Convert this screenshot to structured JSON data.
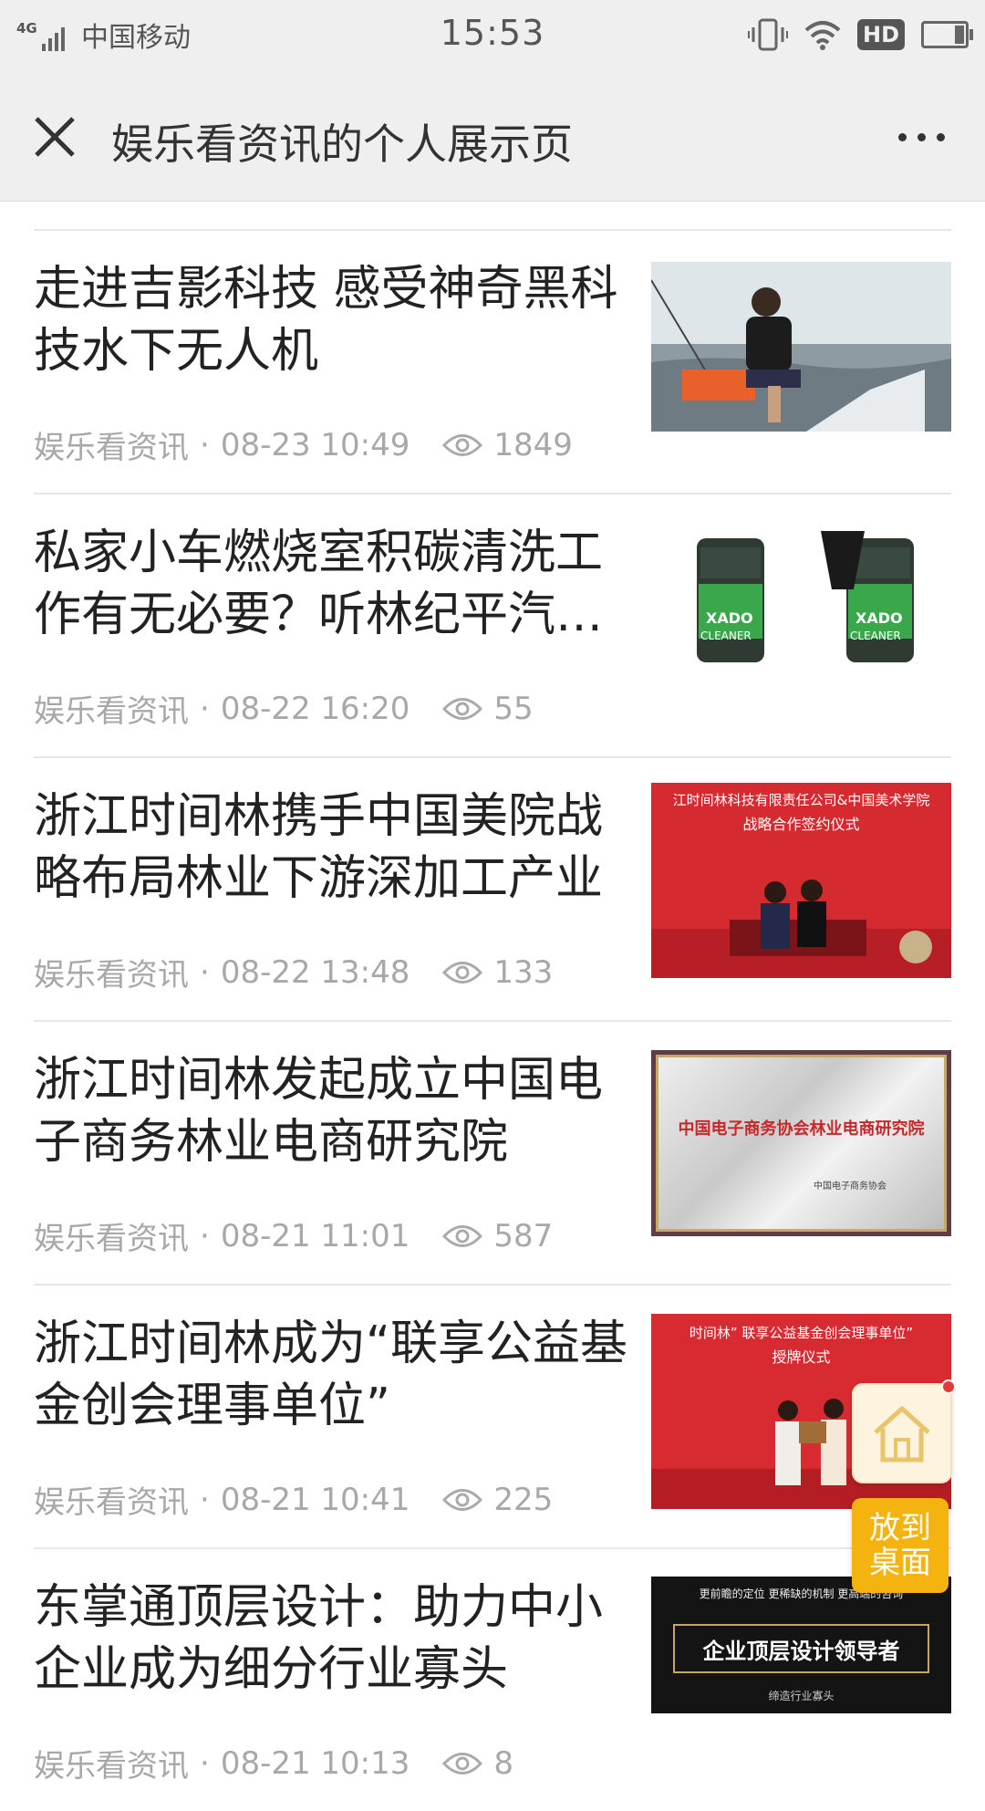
{
  "status_bar": {
    "network": "4G",
    "carrier": "中国移动",
    "time": "15:53",
    "hd": "HD"
  },
  "navbar": {
    "title": "娱乐看资讯的个人展示页"
  },
  "articles": [
    {
      "title": "走进吉影科技 感受神奇黑科技水下无人机",
      "source": "娱乐看资讯",
      "time": "08-23 10:49",
      "views": "1849"
    },
    {
      "title": "私家小车燃烧室积碳清洗工作有无必要？听林纪平汽车专家分析",
      "source": "娱乐看资讯",
      "time": "08-22 16:20",
      "views": "55"
    },
    {
      "title": "浙江时间林携手中国美院战略布局林业下游深加工产业",
      "source": "娱乐看资讯",
      "time": "08-22 13:48",
      "views": "133"
    },
    {
      "title": "浙江时间林发起成立中国电子商务林业电商研究院",
      "source": "娱乐看资讯",
      "time": "08-21 11:01",
      "views": "587"
    },
    {
      "title": "浙江时间林成为“联享公益基金创会理事单位”",
      "source": "娱乐看资讯",
      "time": "08-21 10:41",
      "views": "225"
    },
    {
      "title": "东掌通顶层设计：助力中小企业成为细分行业寡头",
      "source": "娱乐看资讯",
      "time": "08-21 10:13",
      "views": "8"
    }
  ],
  "thumb_text": {
    "t2_label": "XADO",
    "t2_label2": "CLEANER",
    "t3_banner1": "江时间林科技有限责任公司&中国美术学院",
    "t3_banner2": "战略合作签约仪式",
    "t4_plaque": "中国电子商务协会林业电商研究院",
    "t4_org": "中国电子商务协会",
    "t5_banner1": "时间林” 联享公益基金创会理事单位”",
    "t5_banner2": "授牌仪式",
    "t6_top": "更前瞻的定位 更稀缺的机制 更高端的咨询",
    "t6_main": "企业顶层设计领导者",
    "t6_bottom": "缔造行业寡头"
  },
  "floating": {
    "desktop_label": "放到桌面"
  },
  "colors": {
    "bar_bg": "#efefef",
    "meta_text": "#a8a8a8",
    "fab_orange": "#f5b30f"
  }
}
